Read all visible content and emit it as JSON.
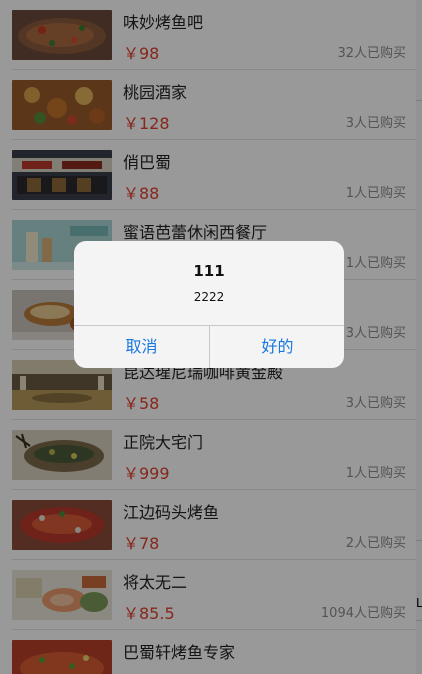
{
  "restaurants": [
    {
      "name": "味妙烤鱼吧",
      "price": "￥98",
      "sold": "32人已购买",
      "image": "grilled-fish-photo"
    },
    {
      "name": "桃园酒家",
      "price": "￥128",
      "sold": "3人已购买",
      "image": "dish-photo"
    },
    {
      "name": "俏巴蜀",
      "price": "￥88",
      "sold": "1人已购买",
      "image": "storefront-photo"
    },
    {
      "name": "蜜语芭蕾休闲西餐厅",
      "price": "",
      "sold": "1人已购买",
      "image": "drink-photo"
    },
    {
      "name": "",
      "price": "",
      "sold": "3人已购买",
      "image": "pastry-photo"
    },
    {
      "name": "昆达瑆尼瑞咖啡黄金殿",
      "price": "￥58",
      "sold": "3人已购买",
      "image": "banquet-hall-photo"
    },
    {
      "name": "正院大宅门",
      "price": "￥999",
      "sold": "1人已购买",
      "image": "fish-dish-photo"
    },
    {
      "name": "江边码头烤鱼",
      "price": "￥78",
      "sold": "2人已购买",
      "image": "grilled-fish-photo"
    },
    {
      "name": "将太无二",
      "price": "￥85.5",
      "sold": "1094人已购买",
      "image": "sushi-photo"
    },
    {
      "name": "巴蜀轩烤鱼专家",
      "price": "",
      "sold": "",
      "image": "spicy-fish-photo"
    }
  ],
  "side_glyph": "L",
  "alert": {
    "title": "111",
    "message": "2222",
    "cancel_label": "取消",
    "ok_label": "好的"
  },
  "colors": {
    "price": "#e0422f",
    "alert_button": "#1878e0",
    "overlay": "rgba(0,0,0,0.40)"
  }
}
